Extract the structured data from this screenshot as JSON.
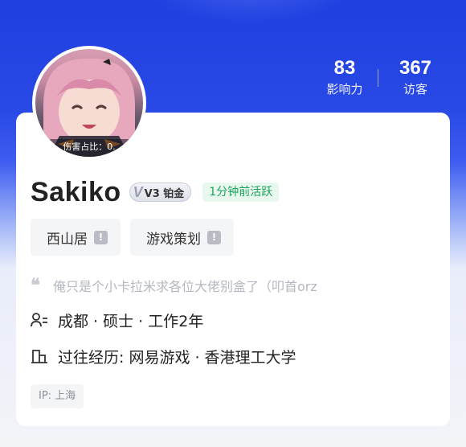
{
  "stats": {
    "influence": {
      "value": "83",
      "label": "影响力"
    },
    "visitors": {
      "value": "367",
      "label": "访客"
    }
  },
  "avatar": {
    "caption": "伤害占比：0."
  },
  "profile": {
    "name": "Sakiko",
    "level_badge": "V3 铂金",
    "active_status": "1分钟前活跃"
  },
  "tags": [
    {
      "label": "西山居",
      "icon": "info-icon"
    },
    {
      "label": "游戏策划",
      "icon": "info-icon"
    }
  ],
  "bio": {
    "icon": "quote-icon",
    "text": "俺只是个小卡拉米求各位大佬别盒了（叩首orz"
  },
  "info": {
    "basic": {
      "icon": "user-list-icon",
      "text": "成都 · 硕士 · 工作2年"
    },
    "history": {
      "icon": "building-icon",
      "text": "过往经历: 网易游戏 · 香港理工大学"
    }
  },
  "ip": {
    "text": "IP: 上海"
  },
  "colors": {
    "header_blue": "#1f3fe0",
    "active_green": "#1aa35a",
    "card_bg": "#ffffff"
  }
}
